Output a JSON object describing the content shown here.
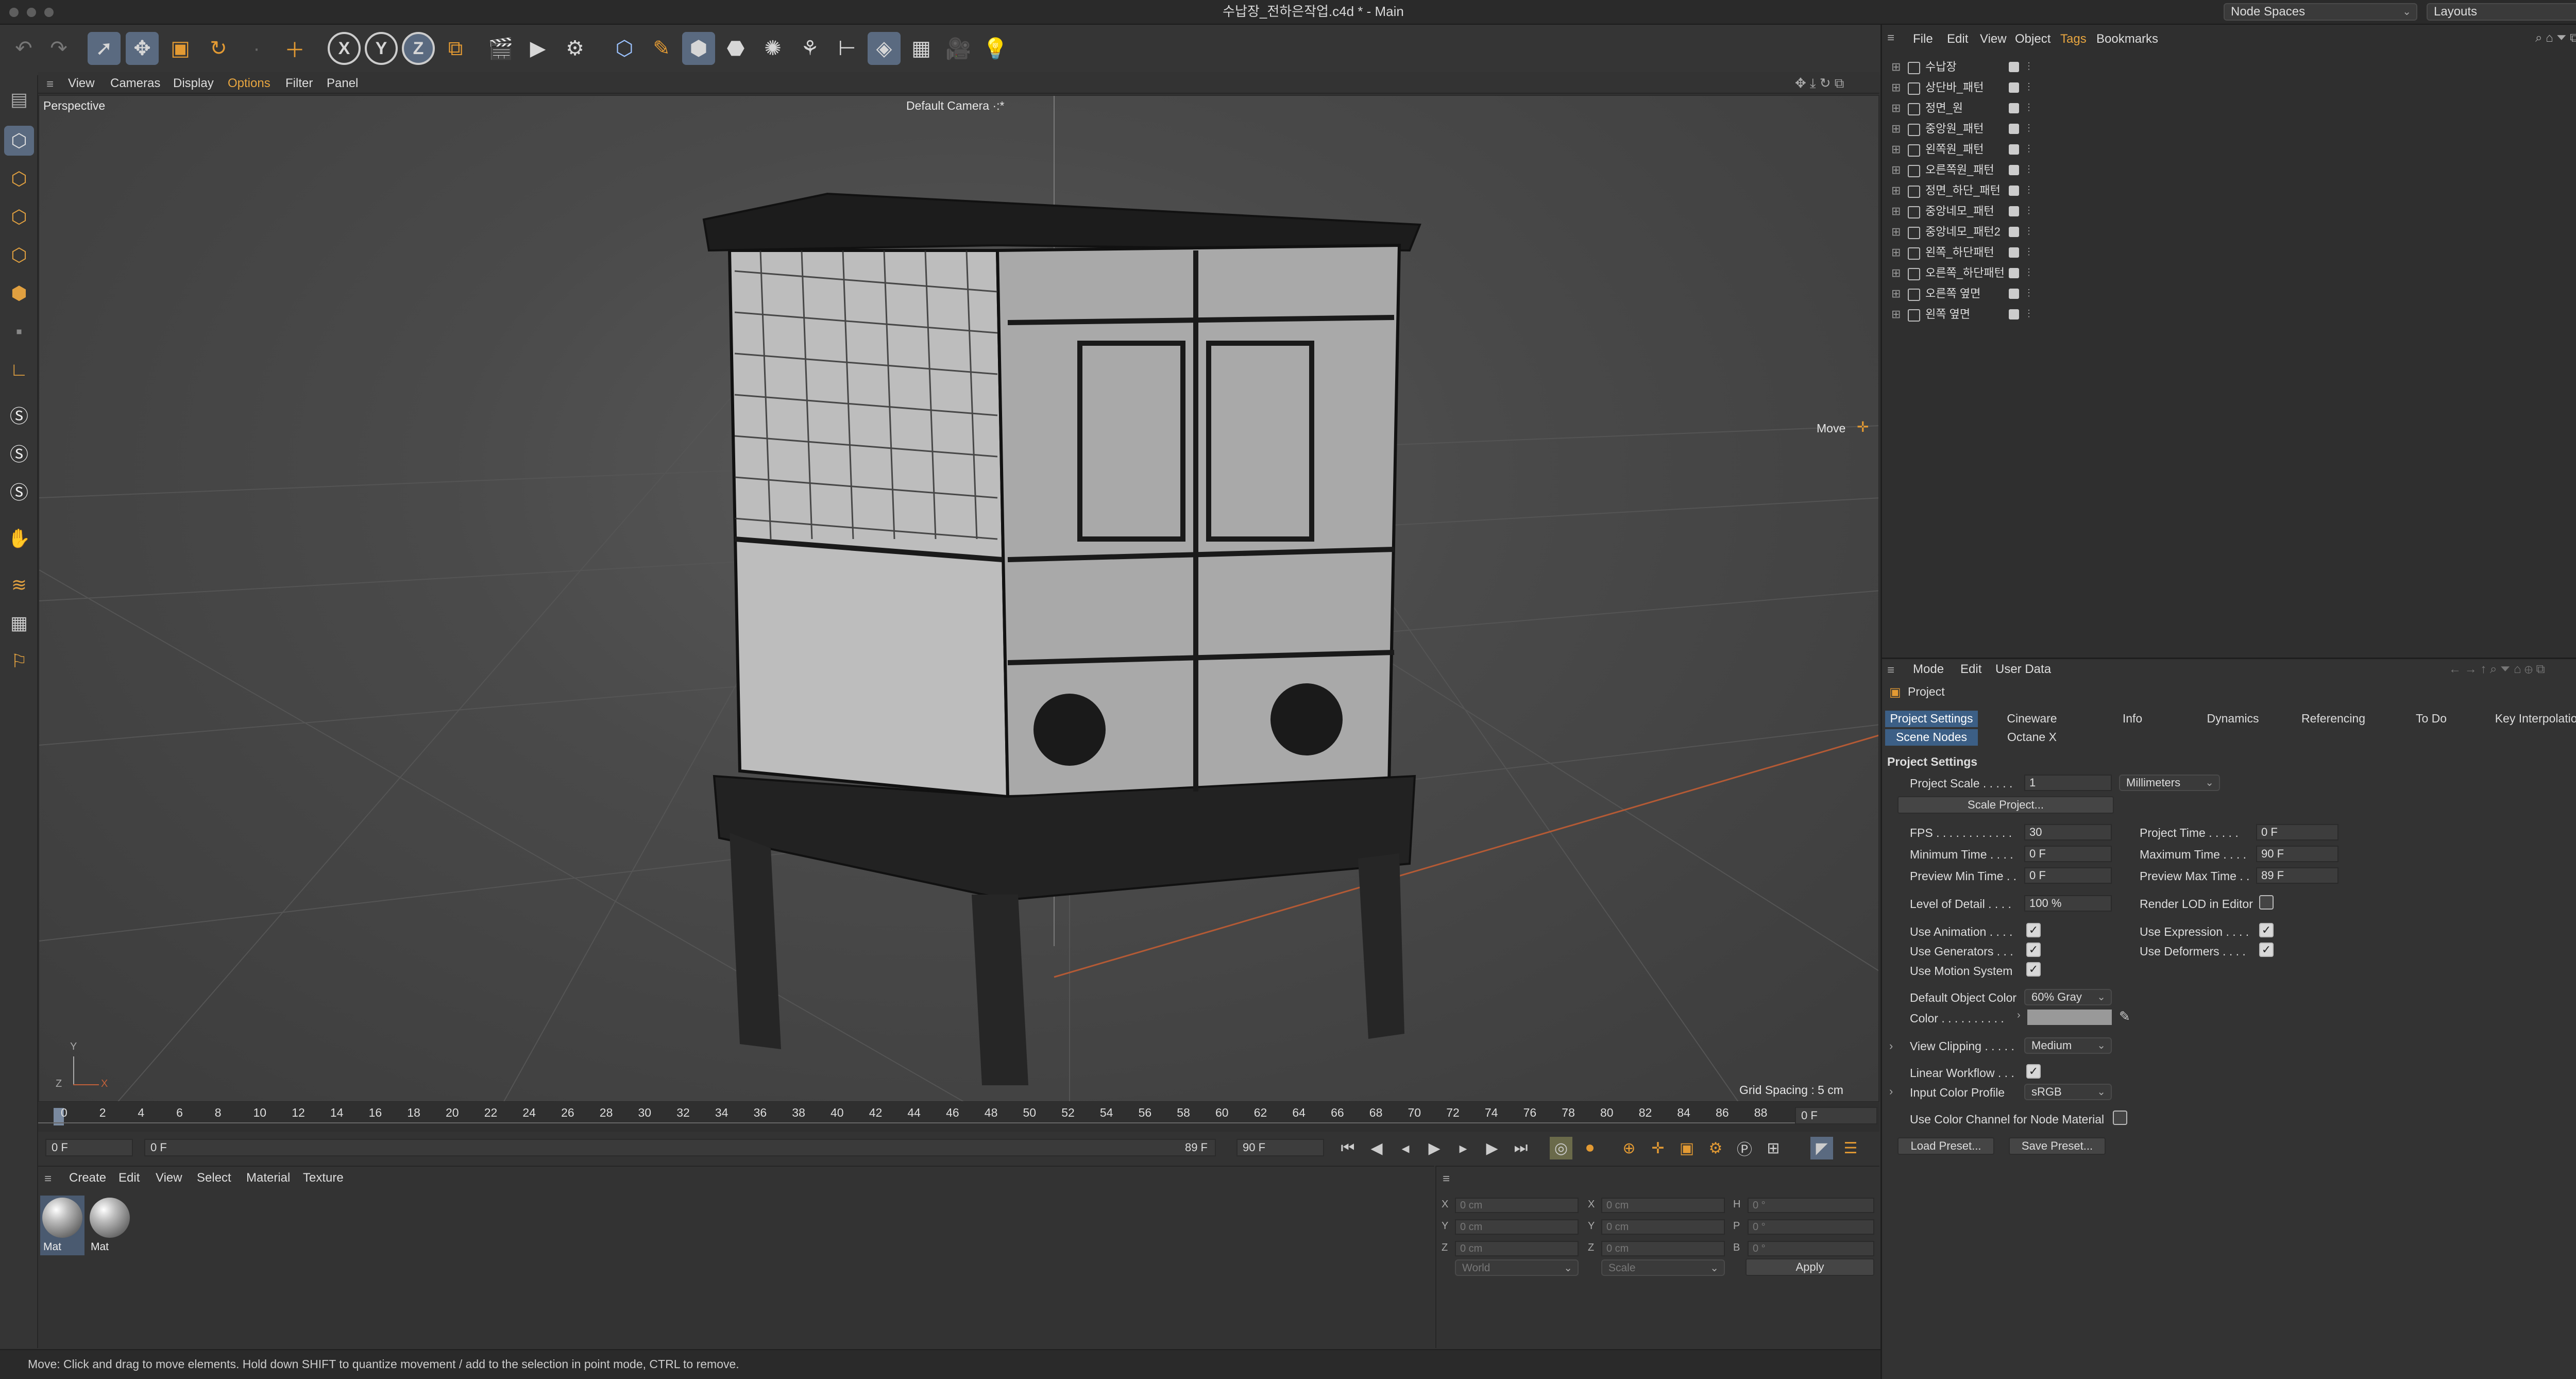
{
  "window": {
    "title": "수납장_전하은작업.c4d * - Main",
    "node_spaces": "Node Spaces",
    "layouts": "Layouts"
  },
  "viewport_menu": [
    "View",
    "Cameras",
    "Display",
    "Options",
    "Filter",
    "Panel"
  ],
  "viewport": {
    "mode": "Perspective",
    "camera": "Default Camera ·:*",
    "tool_hint": "Move",
    "grid_spacing": "Grid Spacing : 5 cm"
  },
  "timeline": {
    "ticks": [
      "0",
      "2",
      "4",
      "6",
      "8",
      "10",
      "12",
      "14",
      "16",
      "18",
      "20",
      "22",
      "24",
      "26",
      "28",
      "30",
      "32",
      "34",
      "36",
      "38",
      "40",
      "42",
      "44",
      "46",
      "48",
      "50",
      "52",
      "54",
      "56",
      "58",
      "60",
      "62",
      "64",
      "66",
      "68",
      "70",
      "72",
      "74",
      "76",
      "78",
      "80",
      "82",
      "84",
      "86",
      "88"
    ],
    "current_frame": "0 F",
    "start_field": "0 F",
    "range_start": "0 F",
    "range_end": "89 F",
    "end_field": "90 F"
  },
  "material_menu": [
    "Create",
    "Edit",
    "View",
    "Select",
    "Material",
    "Texture"
  ],
  "materials": [
    {
      "label": "Mat"
    },
    {
      "label": "Mat"
    }
  ],
  "coords": {
    "rows": [
      {
        "a": "X",
        "av": "0 cm",
        "b": "X",
        "bv": "0 cm",
        "c": "H",
        "cv": "0 °"
      },
      {
        "a": "Y",
        "av": "0 cm",
        "b": "Y",
        "bv": "0 cm",
        "c": "P",
        "cv": "0 °"
      },
      {
        "a": "Z",
        "av": "0 cm",
        "b": "Z",
        "bv": "0 cm",
        "c": "B",
        "cv": "0 °"
      }
    ],
    "world": "World",
    "scale": "Scale",
    "apply": "Apply"
  },
  "status": "Move: Click and drag to move elements. Hold down SHIFT to quantize movement / add to the selection in point mode, CTRL to remove.",
  "object_menu": [
    "File",
    "Edit",
    "View",
    "Object",
    "Tags",
    "Bookmarks"
  ],
  "objects": [
    "수납장",
    "상단바_패턴",
    "정면_원",
    "중앙원_패턴",
    "왼쪽원_패턴",
    "오른쪽원_패턴",
    "정면_하단_패턴",
    "중앙네모_패턴",
    "중앙네모_패턴2",
    "왼쪽_하단패턴",
    "오른쪽_하단패턴",
    "오른쪽 옆면",
    "왼쪽 옆면"
  ],
  "attr_menu": [
    "Mode",
    "Edit",
    "User Data"
  ],
  "attr": {
    "header": "Project",
    "tabs_row1": [
      "Project Settings",
      "Cineware",
      "Info",
      "Dynamics",
      "Referencing",
      "To Do",
      "Key Interpolation"
    ],
    "tabs_row2": [
      "Scene Nodes",
      "Octane X"
    ],
    "section": "Project Settings",
    "project_scale_label": "Project Scale . . . . .",
    "project_scale": "1",
    "project_units": "Millimeters",
    "scale_project_btn": "Scale Project...",
    "fps_label": "FPS . . . . . . . . . . . .",
    "fps": "30",
    "project_time_label": "Project Time . . . . .",
    "project_time": "0 F",
    "min_time_label": "Minimum Time . . . .",
    "min_time": "0 F",
    "max_time_label": "Maximum Time . . . .",
    "max_time": "90 F",
    "prev_min_label": "Preview Min Time . .",
    "prev_min": "0 F",
    "prev_max_label": "Preview Max Time . .",
    "prev_max": "89 F",
    "lod_label": "Level of Detail . . . .",
    "lod": "100 %",
    "render_lod_label": "Render LOD in Editor",
    "use_anim_label": "Use Animation . . . .",
    "use_expr_label": "Use Expression . . . .",
    "use_gen_label": "Use Generators . . .",
    "use_def_label": "Use Deformers . . . .",
    "use_motion_label": "Use Motion System",
    "default_color_label": "Default Object Color",
    "default_color": "60% Gray",
    "color_label": "Color . . . . . . . . . .",
    "view_clip_label": "View Clipping . . . . .",
    "view_clip": "Medium",
    "linear_wf_label": "Linear Workflow . . .",
    "input_profile_label": "Input Color Profile",
    "input_profile": "sRGB",
    "node_mat_label": "Use Color Channel for Node Material",
    "load_preset": "Load Preset...",
    "save_preset": "Save Preset..."
  },
  "colors": {
    "accent_tab": "#3c5f86",
    "selection": "#5a6a80",
    "axis_x": "#c0603a"
  }
}
